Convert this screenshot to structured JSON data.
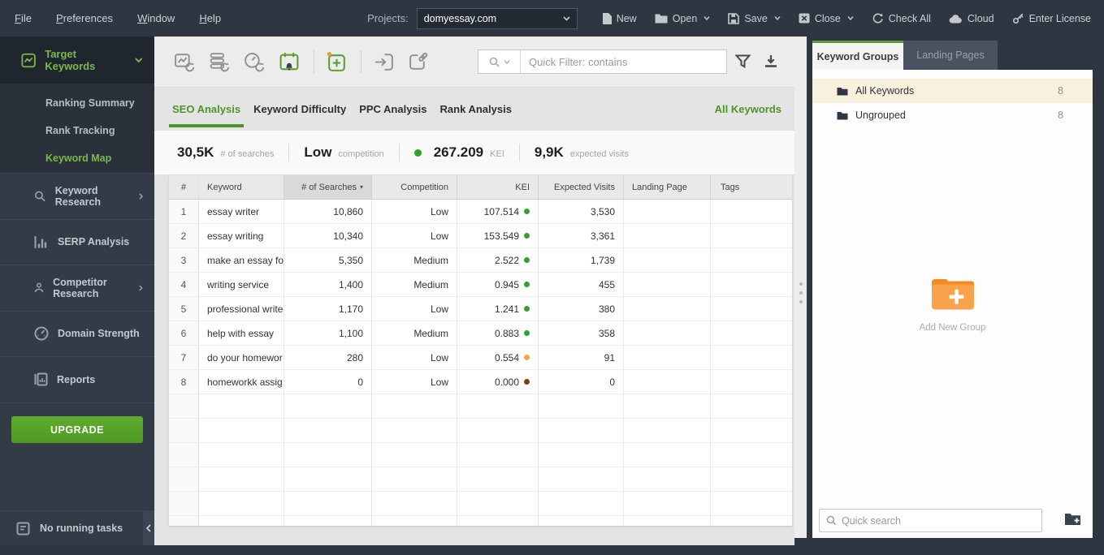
{
  "colors": {
    "accent_green": "#5d9e31",
    "sidebar_green": "#7cb84e",
    "kei_green": "#2fa12c",
    "kei_orange": "#f2a93d",
    "kei_dark_red": "#7e3f10",
    "selected_group_bg": "#f8f1dd",
    "folder_orange": "#f6911e",
    "upgrade_green": "#57a52a",
    "frame_dark": "#2e3641"
  },
  "icons": {
    "sort_desc": "▾"
  },
  "topbar": {
    "menus": [
      "File",
      "Preferences",
      "Window",
      "Help"
    ],
    "projects_label": "Projects:",
    "project_selected": "domyessay.com",
    "actions": [
      "New",
      "Open",
      "Save",
      "Close",
      "Check All",
      "Cloud",
      "Enter License"
    ]
  },
  "sidebar": {
    "target_keywords": {
      "label": "Target Keywords",
      "items": [
        "Ranking Summary",
        "Rank Tracking",
        "Keyword Map"
      ],
      "active_item": "Keyword Map"
    },
    "items": [
      "Keyword Research",
      "SERP Analysis",
      "Competitor Research",
      "Domain Strength",
      "Reports"
    ],
    "upgrade_label": "UPGRADE",
    "status_label": "No running tasks"
  },
  "toolbar": {
    "quick_filter_placeholder": "Quick Filter: contains"
  },
  "content_tabs": {
    "items": [
      "SEO Analysis",
      "Keyword Difficulty",
      "PPC Analysis",
      "Rank Analysis"
    ],
    "active": "SEO Analysis",
    "scope_label": "All Keywords"
  },
  "summary": [
    {
      "value": "30,5K",
      "label": "# of searches"
    },
    {
      "value": "Low",
      "label": "competition"
    },
    {
      "value": "267.209",
      "label": "KEI",
      "dot": "#2fa12c"
    },
    {
      "value": "9,9K",
      "label": "expected visits"
    }
  ],
  "table": {
    "columns": [
      "#",
      "Keyword",
      "# of Searches",
      "Competition",
      "KEI",
      "Expected Visits",
      "Landing Page",
      "Tags"
    ],
    "sorted_column": "# of Searches",
    "rows": [
      {
        "num": "1",
        "keyword": "essay writer",
        "searches": "10,860",
        "competition": "Low",
        "kei": "107.514",
        "kei_dot": "#2fa12c",
        "visits": "3,530"
      },
      {
        "num": "2",
        "keyword": "essay writing",
        "searches": "10,340",
        "competition": "Low",
        "kei": "153.549",
        "kei_dot": "#2fa12c",
        "visits": "3,361"
      },
      {
        "num": "3",
        "keyword": "make an essay fo",
        "searches": "5,350",
        "competition": "Medium",
        "kei": "2.522",
        "kei_dot": "#2fa12c",
        "visits": "1,739"
      },
      {
        "num": "4",
        "keyword": "writing service",
        "searches": "1,400",
        "competition": "Medium",
        "kei": "0.945",
        "kei_dot": "#2fa12c",
        "visits": "455"
      },
      {
        "num": "5",
        "keyword": "professional write",
        "searches": "1,170",
        "competition": "Low",
        "kei": "1.241",
        "kei_dot": "#2fa12c",
        "visits": "380"
      },
      {
        "num": "6",
        "keyword": "help with essay",
        "searches": "1,100",
        "competition": "Medium",
        "kei": "0.883",
        "kei_dot": "#2fa12c",
        "visits": "358"
      },
      {
        "num": "7",
        "keyword": "do your homewor",
        "searches": "280",
        "competition": "Low",
        "kei": "0.554",
        "kei_dot": "#f2a93d",
        "visits": "91"
      },
      {
        "num": "8",
        "keyword": "homeworkk assig",
        "searches": "0",
        "competition": "Low",
        "kei": "0.000",
        "kei_dot": "#7e3f10",
        "visits": "0"
      }
    ]
  },
  "right_panel": {
    "tabs": [
      "Keyword Groups",
      "Landing Pages"
    ],
    "active_tab": "Keyword Groups",
    "groups": [
      {
        "label": "All Keywords",
        "count": "8",
        "selected": true
      },
      {
        "label": "Ungrouped",
        "count": "8",
        "selected": false
      }
    ],
    "add_group_label": "Add New Group",
    "search_placeholder": "Quick search"
  }
}
